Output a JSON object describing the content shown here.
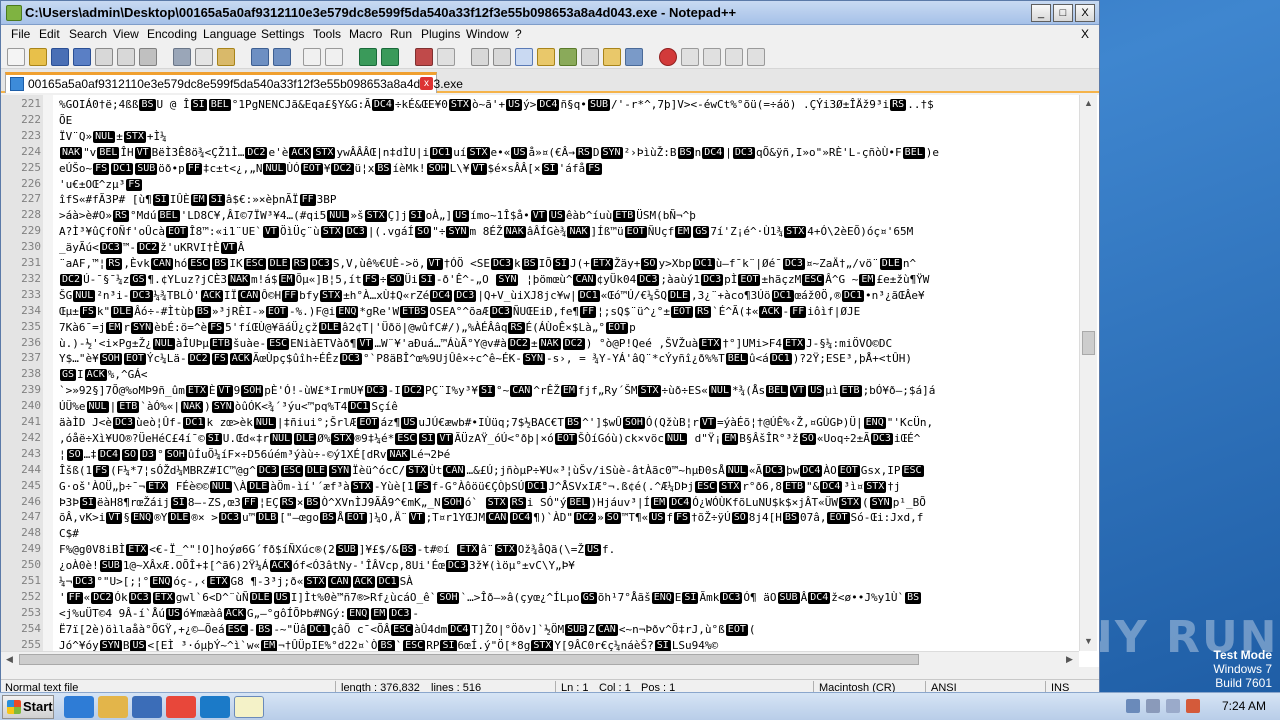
{
  "window": {
    "title": "C:\\Users\\admin\\Desktop\\00165a5a0af9312110e3e579dc8e599f5da540a33f12f3e55b098653a8a4d043.exe - Notepad++",
    "min_label": "_",
    "max_label": "□",
    "close_label": "X"
  },
  "menu": [
    "File",
    "Edit",
    "Search",
    "View",
    "Encoding",
    "Language",
    "Settings",
    "Tools",
    "Macro",
    "Run",
    "Plugins",
    "Window",
    "?"
  ],
  "menu_close": "X",
  "tab": {
    "label": "00165a5a0af9312110e3e579dc8e599f5da540a33f12f3e55b098653a8a4d043.exe",
    "close": "x"
  },
  "lines": [
    {
      "n": "221",
      "t": "%GOIÁ0†ë;4ßßBSU @  ÎSIBEL°1PgNENCJã&Eqa£§Y&G:ÃDC4÷kÉ&ŒE¥0STXò~ã'+USý>DC4ñ§q•SUB/'-r*^,7þ]V><-éwCt%°õü(=÷áö)  .ÇÝi3Ø±ÎÄž9³iRS..†$"
    },
    {
      "n": "222",
      "t": "ÕE"
    },
    {
      "n": "223",
      "t": "ÏV¨Q»NUL±STX+Ì¼"
    },
    {
      "n": "224",
      "t": "NAK\"vBELÎHVTBëÌ3Ê8ö¾<ÇŽ1Ì…DC2e'èACKSTXywÂÂÂŒ|n‡dÌU|iDC1uíSTXe•«USå»¤(€Â→RSDSYN²›ÞìùŽ:BBSnDC4|DC3qÕ&ÿñ,I»o\"»RÈ'L-çñòÙ•FBEL)e"
    },
    {
      "n": "225",
      "t": "eÚŠo~FSDC1SUBöð•pFF‡c±t<¿,„NNULÙÓEOT¥DC2ü¦xBSíèMk!SOHL\\¥VT$é×sÂÂ[×SI'áfåFS"
    },
    {
      "n": "226",
      "t": "'u€±OŒ^zµ³FS"
    },
    {
      "n": "227",
      "t": "îfS«#fÃ3P# [ù¶SIIÛÈEMSIâ$€:»×èþnÃÏFF3BP"
    },
    {
      "n": "228",
      "t": ">áà>è#O»RS°MdúBEL'LD8C¥,ÂI©7ÏW³¥4…(#qi5NUL»šSTXÇ]jSIoÀ„]USímo~1Î$å•VTUSêàb^íuùETBÜSM(bÑ¬^þ"
    },
    {
      "n": "229",
      "t": "A?Ì³¥ûÇfOÑf'oÛcàEOTÎ8™:«i1¨UE`VTÖìÜç¨ùSTXDC3|(.vgáÍSO\"÷SYNm 8ÉŽNAKâÂÍGè¾NAK]Íß™üEOTÑUçfEMGS7í'Z¡é^·Ù1¾STX4+Ó\\2èEÕ)óç¤'65M"
    },
    {
      "n": "230",
      "t": "_äyÃú<DC3™-DC2ž'uKRVI†ÈVTÂ"
    },
    {
      "n": "231",
      "t": "¨aAF,™¦RS,ÈvkCANhóESCBSIKESCDLERSDC3S,V,ùê%€UÈ->ö,VT†ÓÖ <SEDC3kBSIÕSIJ(+ETXŽäy+SOy>XbpDC1ù–f¯k¨|Øé¯DC3¤~ZaÄ†„/vö¨DLEn^"
    },
    {
      "n": "232",
      "t": "DC2Ú-¯§¯¼zGS¶.¢YLuz?jCÈ3NAKm!á$EMÕµ«]B¦5,ítFS÷SOÜiSI-ð'Ê^-„O SYN ¦þömœù^CAN¢yÜk04DC3;àaùý1DC3pÌEOT±hãçzMESCÂ^G ~EM£e±žù¶ŸW"
    },
    {
      "n": "233",
      "t": "ŠGNUL²n³i-DC3¼¾TBLÒ'ACKIÏCANÔ©HFFbfySTX±h°À…xÙ‡Q«rZéDC4DC3|Q+V_ùiXJ8jc¥w|DC1«Œó™Ú/€¼ŠQDLE,3¿¨+àco¶3ÚöDC1œáž0Ö,®DC1•n³¿ãŒÂe¥"
    },
    {
      "n": "234",
      "t": "Œµ±FSk\"DLEÂó÷-#ÌtùþBS»³jRÈI-»EOT-%.)F@iENQ*gRe'WETBSOSEA°^õaÆDC3ÑUŒEiÐ,fe¶FF¦;sQ$¨ü^¿°±EOTRS`É^Ã(‡«ACK-FFiôìf|ØJE"
    },
    {
      "n": "235",
      "t": "7Kà6¯=jEMrSYNèbÉ:ö=^èFS5'fíŒÙ@¥ãáÜ¿çžDLEâ2¢T|'Üðö|@wûfC#/)„%ÀÉÂâqRSÉ(ÁÙoÊ×$Là„°EOTp"
    },
    {
      "n": "236",
      "t": "ù.)-½'<i×Pg±Ž¿NULàÎUÞµETBšuàe-ESCENiàETVàð¶VT…W¨¥'aÐuá…™ÁùÃ°Y@v#àDC2±NAKDC2)    °ò@P!Qeé ,ŠVŽuàETX†°]UMi>F4ETXJ-§¼:miÖVO©DC"
    },
    {
      "n": "237",
      "t": "Y$…\"è¥SOHEOTÝc¼Lä-DC2FSACKÃœÙpç$ûîh÷ÉÊzDC3°`P8äBÎ^œ%9UjÛê×÷c^ê~ÉK-SYN-s›, = ¾Y-YÁ'âQ¨*cÝyñî¿ð%%TBELû<áDC1)?2Ÿ;ESE³,þÅ+<tÛH)"
    },
    {
      "n": "238",
      "t": "GSIACK%,^GÁ<"
    },
    {
      "n": "239",
      "t": "`>»92§]7Õ@%oMÞ9ñ_ûmETXÈVT9SOHpÈ'Ó!-ùW£*IrmU¥DC3-IDC2PÇ¨I%y³¥SI°~CAN^rÊŽEMfjf„Ry´ŠMSTX÷ùð÷ES«NUL*¾(ÅsBELVTUSµìETB;bÓ¥ð—;$á]á"
    },
    {
      "n": "240",
      "t": "ÚÜ%eNUL|ETB`àÓ%«|NAK)SYNòûÓK<¾´³ýu<™pq%T4DC1Sçíê"
    },
    {
      "n": "241",
      "t": "äàÌD J<èDC3ùeò¦Ûf-DC1k zœ>èkNUL|‡ñiui°;ŠrlÆEOTáz¶USuJÚ€æwb#•IÙüq;7$½BAC€TBS^']$wÛSOHÓ(QžùB¦rVT=ýàÉõ¦†@ÚÊ%‹Ž,¤GÙGÞ)Ü|ENQ\"'KcÜn,"
    },
    {
      "n": "242",
      "t": ",óåë÷Xì¥UO®?ÜeHéC£4í¯©SIU.Œd«‡rNULDLEØ%STX®9‡¼é*ESCSIVTÃÜzAŸ_óÚ<°ðþ|×óEOTŠÒíGóù)ck×vöcNUL d\"Ÿ¡EMB§ÂšÎR°³žSO«Uoq÷2±ÃDC3iŒÉ^"
    },
    {
      "n": "243",
      "t": "¦SO…‡DC4SOD3°SOHûÍuÕ¼íF×÷D56úém³ýàù÷-©ý1XÉ[dRvNAKLé¬2Þé"
    },
    {
      "n": "244",
      "t": "Îšß(1FS(F¼*7¦sÓŽd¼MBRZ#IC™@g^DC3ESCDLESYNÏèü^ócC/STXÙtCAN…&£Ú;jñòµP÷¥U«³¦ùŠv/iSùè-âtÀãc0™~hµÐ0sÅNUL«ÃDC3þwDC4ÀOEOTGsx,IPESC"
    },
    {
      "n": "245",
      "t": " G·oš'ÀOÜ„þ÷¯¬ETX   FÉè©©NUL\\ÀDLEàÖm-ìí'´æf³àSTX-Yùè[1FSf-G°Àôöü€ÇÒþSÚDC1J^ÅSVxIÆ°¬.ß¢é(.^Æ¼DÞjESCSTXr°ð6,8ETB\"&DC4³ì¤STX†j"
    },
    {
      "n": "246",
      "t": "Þ3ÞSIëàH8¶rœŽáijSI8—-ZS,œ3FF¦EÇRS×BSÒ^XVnÌJ9ÃÂ9^€mK„_NSOHó`  STXRSi SÓ\"ýBEL)Hjáuv³|ÍEMDC4Ó¿WÓÙKfõLuNU$k$×jÂT«ÜWSTX(SYNp¹_BÕ"
    },
    {
      "n": "247",
      "t": "õÂ,vK>iVT§ENQ®YDLE®×    >DC3u™DLB[\"—œgoBSÅEOT]¼O,Ä¨VT;T¤r1YŒJMCANDC4¶)`ÀD\"DC2»SO™T¶«USfFS†õŽ÷ÿÚSO8j4[HBS07â,EOTSó-Œi:Jxd,f"
    },
    {
      "n": "248",
      "t": "C$#"
    },
    {
      "n": "249",
      "t": "F%@g0V8iBÌETX<€-Ï_^\"!O]hoýø6G´fð$íÑXúc®(2SUB]¥£$/&BS-t#©í ETXâ¨STXOž¾åQã(\\=ŽUSf."
    },
    {
      "n": "250",
      "t": "¿oÀ0è!SUB1@~XÂxÆ.OÕÎ+‡[^ã6)2Ÿ¼ÁACKóf<Ó3âtNy-'ÎÂVcp,8Ui'ÉœDC33ž¥(ìöµ°±vC\\Y„Þ¥"
    },
    {
      "n": "251",
      "t": "¼¬DC3°\"U>[;¦°ENQóç-,‹ETXG8 ¶-3³j;ð«STXCANACKDC1SÀ"
    },
    {
      "n": "252",
      "t": "'FF«DC2ÓkDC3ETXgwl`6<D^¨ùÑDLEUSI]Ìt%0è™ñ7®>Rf¿ùcáO_ê`SOH`…>Îð–»â(çyœ¿^ÍLµoGSõh¹7°ÅãšENQESIÃmkDC3Ó¶  äOSUBÂDC4ž<ø••J%y1Ù`BS"
    },
    {
      "n": "253",
      "t": "<j%uÜT©4    9Â-í`ÅúUSó¥mæàâACKG„—°gôÍÕÞb#NGý:ENQEMDC3-"
    },
    {
      "n": "254",
      "t": "Ë7ï[2è)öìlaåà°ÕGŸ,+¿©—ÕeáESC-BS-~\"ÜâDC1çâÕ   c¯<ÕÂESCàÛ4dmDC4T]ŽO|°Öðv]`½ÖMSUBZCAN<~n¬Þðv^Ö‡rJ,ù°ßEOT("
    },
    {
      "n": "255",
      "t": "Jó^¥óySYNBUS<[EÌ_³·óµþÝ~^ì`w«EM¬†ÛÜpIE%°d22¤`ÒBS`ESCRPSI6œÍ.ý\"Ö[*8gSTXY[9ÂC0r€ç¼náèŠ?SILSu94%©"
    }
  ],
  "controls": [
    "NUL",
    "SOH",
    "STX",
    "ETX",
    "EOT",
    "ENQ",
    "ACK",
    "BEL",
    "BS",
    "VT",
    "FF",
    "SO",
    "SI",
    "DLE",
    "DC1",
    "DC2",
    "DC3",
    "DC4",
    "NAK",
    "SYN",
    "ETB",
    "CAN",
    "EM",
    "SUB",
    "ESC",
    "FS",
    "GS",
    "RS",
    "US",
    "DLB",
    "ETBS",
    "D3"
  ],
  "status": {
    "lang": "Normal text file",
    "length": "length : 376,832",
    "lines": "lines : 516",
    "ln": "Ln : 1",
    "col": "Col : 1",
    "pos": "Pos : 1",
    "eol": "Macintosh (CR)",
    "enc": "ANSI",
    "ins": "INS"
  },
  "watermark": "ANY RUN",
  "testmode": {
    "line1": "Test Mode",
    "line2": "Windows 7",
    "line3": "Build 7601"
  },
  "taskbar": {
    "start": "Start",
    "clock": "7:24 AM"
  },
  "colors": {
    "title_grad": "#a6c1e8",
    "tab_accent": "#f0a030",
    "desktop": "#2a6ab8"
  }
}
